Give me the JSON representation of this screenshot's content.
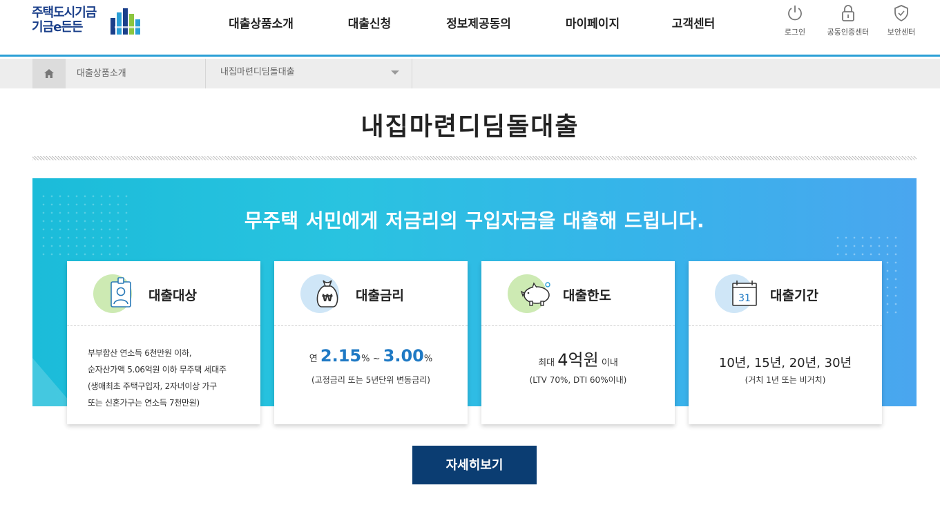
{
  "brand": {
    "line1": "주택도시기금",
    "line2": "기금e든든"
  },
  "nav": {
    "items": [
      {
        "label": "대출상품소개"
      },
      {
        "label": "대출신청"
      },
      {
        "label": "정보제공동의"
      },
      {
        "label": "마이페이지"
      },
      {
        "label": "고객센터"
      }
    ]
  },
  "utility": {
    "login": "로그인",
    "cert": "공동인증센터",
    "security": "보안센터"
  },
  "breadcrumb": {
    "home_icon": "home-icon",
    "level1": "대출상품소개",
    "level2": "내집마련디딤돌대출"
  },
  "page": {
    "title": "내집마련디딤돌대출"
  },
  "banner": {
    "headline": "무주택 서민에게 저금리의 구입자금을 대출해 드립니다."
  },
  "cards": [
    {
      "label": "대출대상",
      "icon": "person-id-icon",
      "lines": [
        "부부합산 연소득 6천만원 이하,",
        "순자산가액 5.06억원 이하 무주택 세대주",
        "(생애최초 주택구입자, 2자녀이상 가구",
        "또는 신혼가구는 연소득 7천만원)"
      ]
    },
    {
      "label": "대출금리",
      "icon": "money-bag-icon",
      "prefix": "연",
      "rate_min": "2.15",
      "rate_unit": "%",
      "sep": "~",
      "rate_max": "3.00",
      "note": "(고정금리 또는 5년단위 변동금리)"
    },
    {
      "label": "대출한도",
      "icon": "piggy-bank-icon",
      "prefix": "최대",
      "amount": "4억원",
      "suffix": "이내",
      "note": "(LTV 70%, DTI 60%이내)"
    },
    {
      "label": "대출기간",
      "icon": "calendar-icon",
      "calendar_day": "31",
      "period": "10년, 15년, 20년, 30년",
      "note": "(거치 1년 또는 비거치)"
    }
  ],
  "actions": {
    "more": "자세히보기"
  },
  "colors": {
    "accent": "#2a9fd6",
    "button": "#0b3d72",
    "rate": "#1e79c4"
  }
}
